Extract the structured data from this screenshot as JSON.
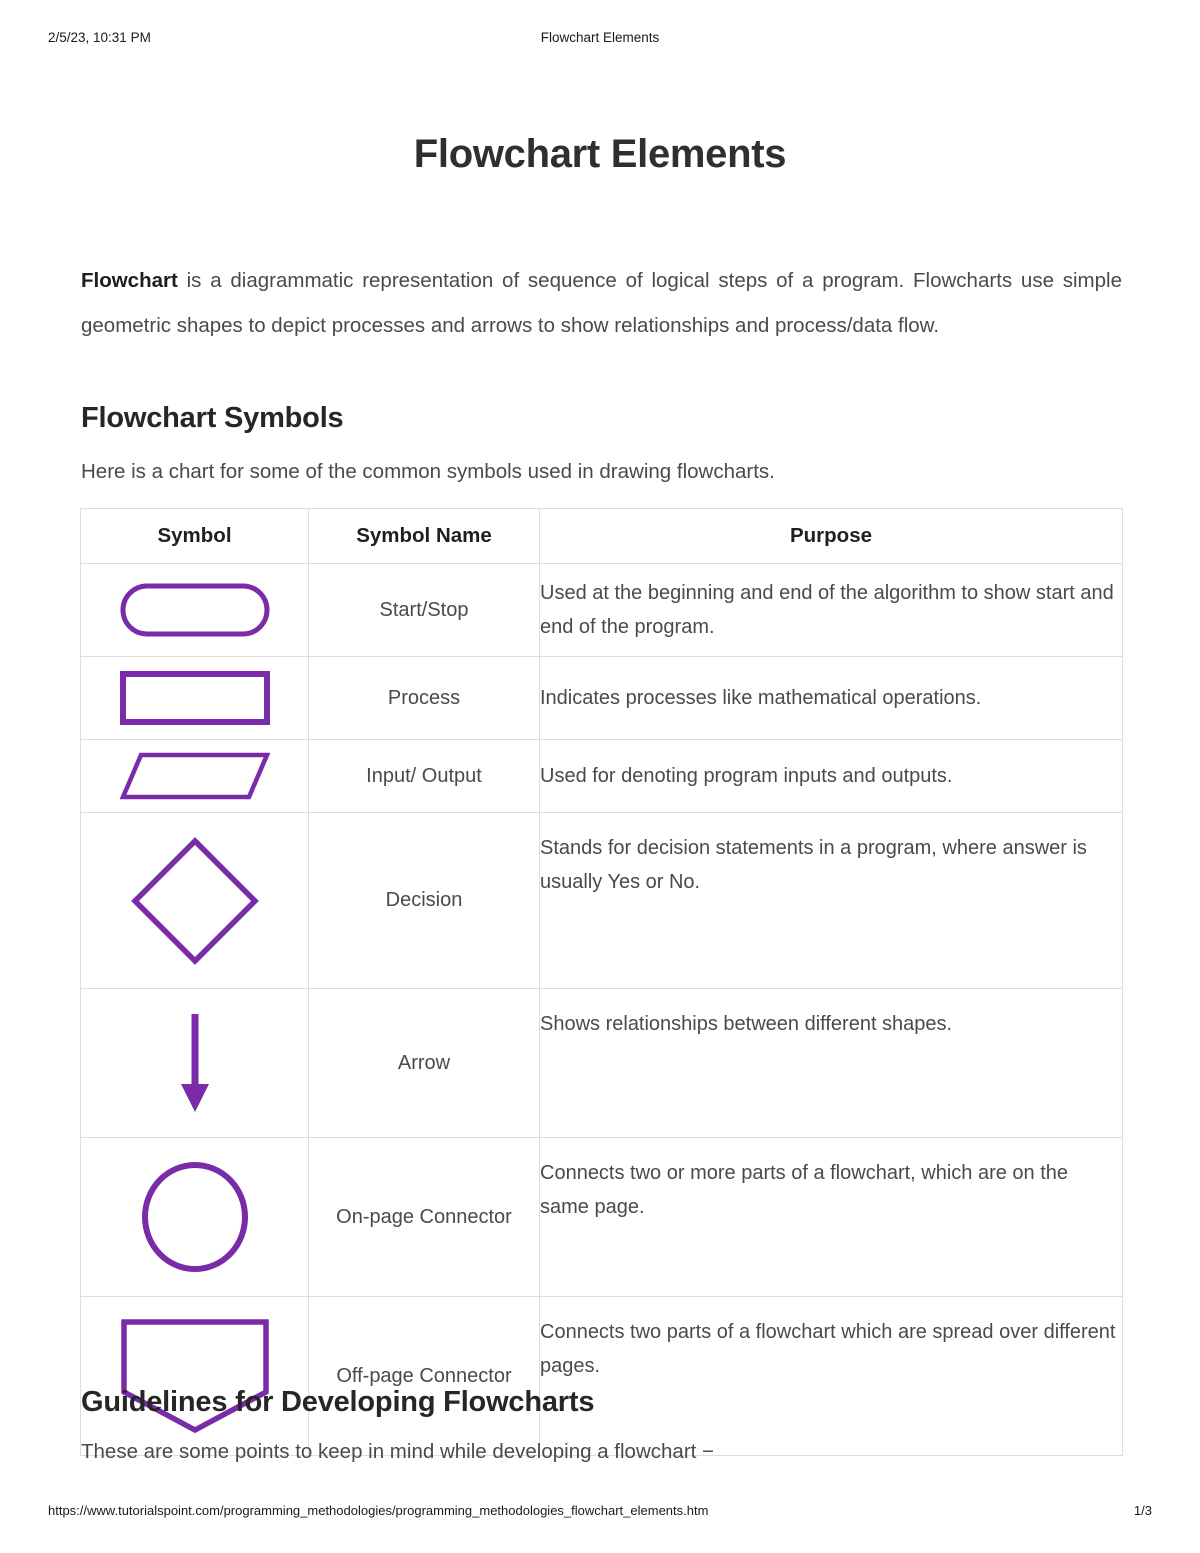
{
  "print_header": {
    "date": "2/5/23, 10:31 PM",
    "title": "Flowchart Elements"
  },
  "document": {
    "title": "Flowchart Elements",
    "intro_bold_lead": "Flowchart",
    "intro_rest": " is a diagrammatic representation of sequence of logical steps of a program. Flowcharts use simple geometric shapes to depict processes and arrows to show relationships and process/data flow."
  },
  "sections": {
    "symbols": {
      "heading": "Flowchart Symbols",
      "lead": "Here is a chart for some of the common symbols used in drawing flowcharts."
    },
    "guidelines": {
      "heading": "Guidelines for Developing Flowcharts",
      "lead": "These are some points to keep in mind while developing a flowchart −"
    }
  },
  "table": {
    "headers": {
      "symbol": "Symbol",
      "symbol_name": "Symbol Name",
      "purpose": "Purpose"
    },
    "rows": [
      {
        "shape": "rounded-rectangle-shape",
        "name": "Start/Stop",
        "purpose": "Used at the beginning and end of the algorithm to show start and end of the program."
      },
      {
        "shape": "rectangle-shape",
        "name": "Process",
        "purpose": "Indicates processes like mathematical operations."
      },
      {
        "shape": "parallelogram-shape",
        "name": "Input/ Output",
        "purpose": "Used for denoting program inputs and outputs."
      },
      {
        "shape": "diamond-shape",
        "name": "Decision",
        "purpose": "Stands for decision statements in a program, where answer is usually Yes or No."
      },
      {
        "shape": "down-arrow-shape",
        "name": "Arrow",
        "purpose": "Shows relationships between different shapes."
      },
      {
        "shape": "circle-shape",
        "name": "On-page Connector",
        "purpose": "Connects two or more parts of a flowchart, which are on the same page."
      },
      {
        "shape": "pentagon-shape",
        "name": "Off-page Connector",
        "purpose": "Connects two parts of a flowchart which are spread over different pages."
      }
    ]
  },
  "print_footer": {
    "url": "https://www.tutorialspoint.com/programming_methodologies/programming_methodologies_flowchart_elements.htm",
    "page": "1/3"
  },
  "colors": {
    "shape_purple": "#7A2BA8",
    "table_border": "#dedede",
    "body_text": "#4a4a4a",
    "heading_text": "#262626"
  }
}
